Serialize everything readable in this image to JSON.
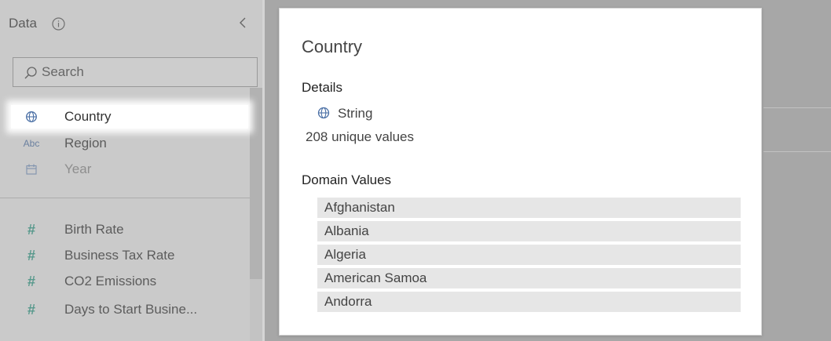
{
  "data_pane": {
    "title": "Data",
    "search": {
      "placeholder": "Search",
      "value": ""
    },
    "dimensions": [
      {
        "label": "Country",
        "icon": "globe-icon",
        "selected": true
      },
      {
        "label": "Region",
        "icon": "abc-icon",
        "icon_text": "Abc"
      },
      {
        "label": "Year",
        "icon": "calendar-icon"
      }
    ],
    "measures": [
      {
        "label": "Birth Rate",
        "icon": "hash-icon",
        "icon_text": "#"
      },
      {
        "label": "Business Tax Rate",
        "icon": "hash-icon",
        "icon_text": "#"
      },
      {
        "label": "CO2 Emissions",
        "icon": "hash-icon",
        "icon_text": "#"
      },
      {
        "label": "Days to Start Busine...",
        "icon": "hash-icon",
        "icon_text": "#"
      }
    ]
  },
  "details_card": {
    "title": "Country",
    "details_heading": "Details",
    "data_type": "String",
    "unique_values": "208 unique values",
    "domain_heading": "Domain Values",
    "domain_values": [
      "Afghanistan",
      "Albania",
      "Algeria",
      "American Samoa",
      "Andorra"
    ]
  },
  "colors": {
    "accent_blue": "#4a6fa5",
    "measure_green": "#2c9b86",
    "panel_bg": "#f0f0f0",
    "canvas_bg": "#a7a7a7"
  }
}
